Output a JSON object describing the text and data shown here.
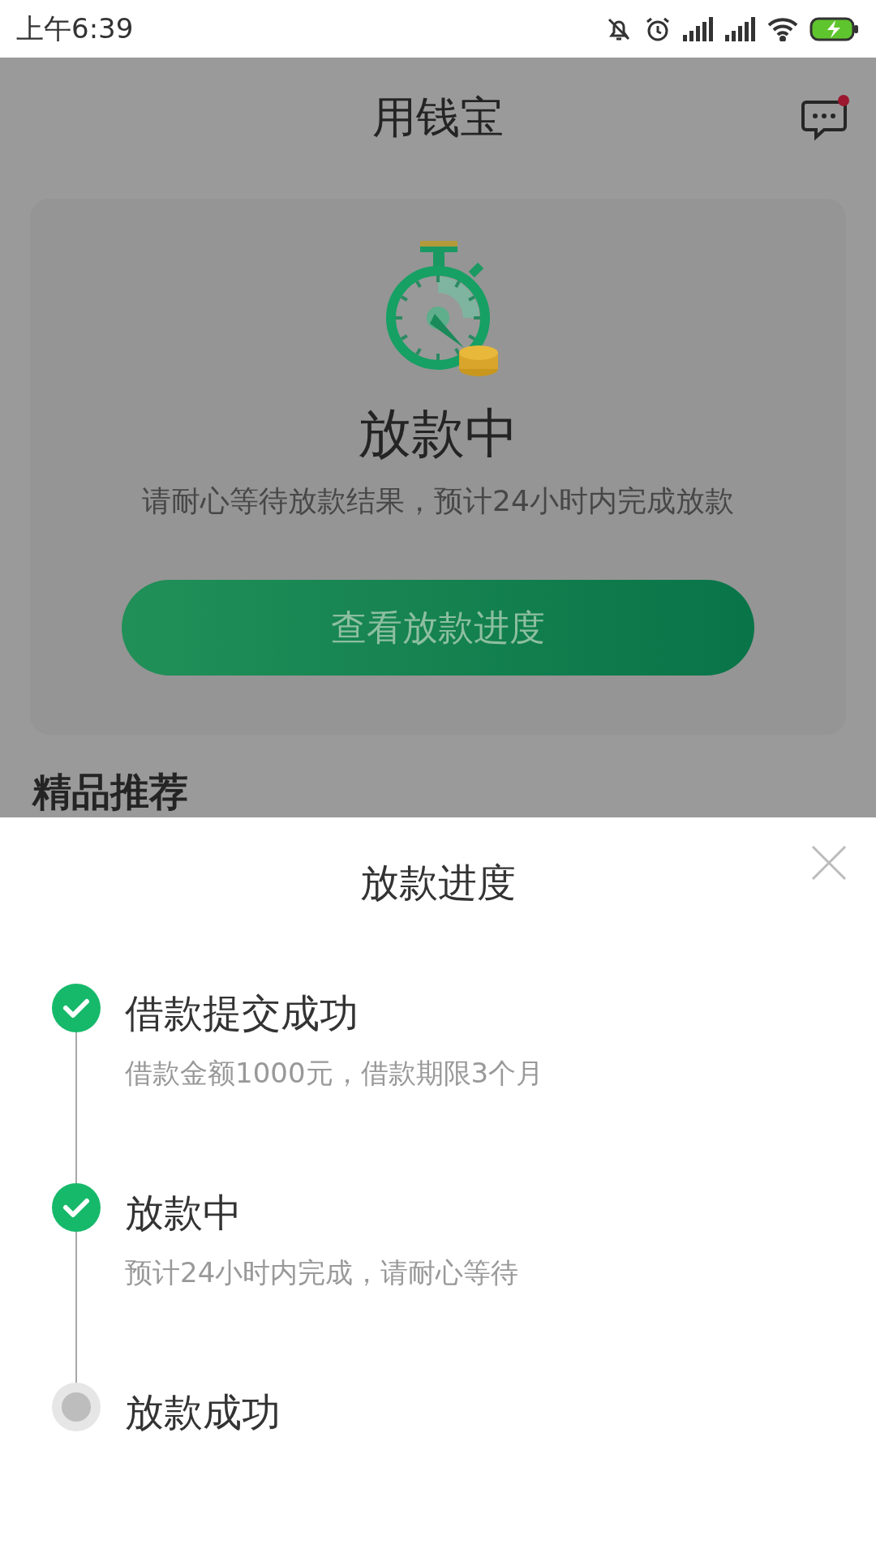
{
  "status_bar": {
    "time": "上午6:39"
  },
  "header": {
    "title": "用钱宝",
    "has_unread": true
  },
  "card": {
    "status_title": "放款中",
    "message": "请耐心等待放款结果，预计24小时内完成放款",
    "button": "查看放款进度"
  },
  "section_title": "精品推荐",
  "sheet": {
    "title": "放款进度",
    "steps": [
      {
        "title": "借款提交成功",
        "detail": "借款金额1000元，借款期限3个月",
        "done": true
      },
      {
        "title": "放款中",
        "detail": "预计24小时内完成，请耐心等待",
        "done": true
      },
      {
        "title": "放款成功",
        "done": false
      }
    ]
  }
}
